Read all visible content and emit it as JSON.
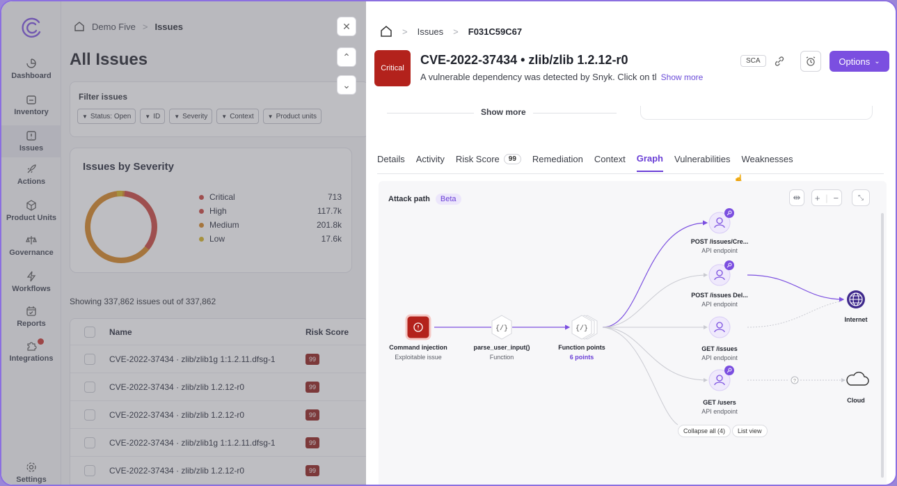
{
  "sidebar": {
    "items": [
      {
        "label": "Dashboard",
        "icon": "dashboard-icon"
      },
      {
        "label": "Inventory",
        "icon": "inventory-icon"
      },
      {
        "label": "Issues",
        "icon": "issues-icon"
      },
      {
        "label": "Actions",
        "icon": "rocket-icon"
      },
      {
        "label": "Product Units",
        "icon": "cube-icon"
      },
      {
        "label": "Governance",
        "icon": "scale-icon"
      },
      {
        "label": "Workflows",
        "icon": "bolt-icon"
      },
      {
        "label": "Reports",
        "icon": "calendar-icon"
      },
      {
        "label": "Integrations",
        "icon": "puzzle-icon"
      },
      {
        "label": "Settings",
        "icon": "gear-icon"
      }
    ]
  },
  "main": {
    "breadcrumb": {
      "home": "Demo Five",
      "current": "Issues"
    },
    "title": "All Issues",
    "filter": {
      "label": "Filter issues",
      "chips": [
        "Status: Open",
        "ID",
        "Severity",
        "Context",
        "Product units"
      ]
    },
    "severity_card": {
      "title": "Issues by Severity",
      "legend": [
        {
          "label": "Critical",
          "value": "713",
          "color": "#c9403a"
        },
        {
          "label": "High",
          "value": "117.7k",
          "color": "#c9403a"
        },
        {
          "label": "Medium",
          "value": "201.8k",
          "color": "#d4811b"
        },
        {
          "label": "Low",
          "value": "17.6k",
          "color": "#d6b21d"
        }
      ]
    },
    "showing": "Showing 337,862 issues out of 337,862",
    "table": {
      "headers": {
        "name": "Name",
        "risk": "Risk Score"
      },
      "rows": [
        {
          "name": "CVE-2022-37434 · zlib/zlib1g 1:1.2.11.dfsg-1",
          "risk": "99"
        },
        {
          "name": "CVE-2022-37434 · zlib/zlib 1.2.12-r0",
          "risk": "99"
        },
        {
          "name": "CVE-2022-37434 · zlib/zlib 1.2.12-r0",
          "risk": "99"
        },
        {
          "name": "CVE-2022-37434 · zlib/zlib1g 1:1.2.11.dfsg-1",
          "risk": "99"
        },
        {
          "name": "CVE-2022-37434 · zlib/zlib 1.2.12-r0",
          "risk": "99"
        }
      ]
    }
  },
  "panel": {
    "breadcrumb": {
      "section": "Issues",
      "id": "F031C59C67"
    },
    "severity": "Critical",
    "title": "CVE-2022-37434 • zlib/zlib 1.2.12-r0",
    "description": "A vulnerable dependency was detected by Snyk. Click on tl",
    "show_more_inline": "Show more",
    "tag": "SCA",
    "options_label": "Options",
    "show_more": "Show more",
    "tabs": [
      {
        "label": "Details"
      },
      {
        "label": "Activity"
      },
      {
        "label": "Risk Score",
        "count": "99"
      },
      {
        "label": "Remediation"
      },
      {
        "label": "Context"
      },
      {
        "label": "Graph",
        "active": true
      },
      {
        "label": "Vulnerabilities"
      },
      {
        "label": "Weaknesses"
      }
    ],
    "graph": {
      "title": "Attack path",
      "beta": "Beta",
      "nodes": {
        "cmd": {
          "label": "Command injection",
          "sub": "Exploitable issue"
        },
        "parse": {
          "label": "parse_user_input()",
          "sub": "Function"
        },
        "fp": {
          "label": "Function points",
          "sub": "6 points"
        },
        "ep1": {
          "label": "POST /issues/Cre...",
          "sub": "API endpoint"
        },
        "ep2": {
          "label": "POST /issues Del...",
          "sub": "API endpoint"
        },
        "ep3": {
          "label": "GET /issues",
          "sub": "API endpoint"
        },
        "ep4": {
          "label": "GET /users",
          "sub": "API endpoint"
        },
        "internet": {
          "label": "Internet"
        },
        "cloud": {
          "label": "Cloud"
        }
      },
      "buttons": {
        "collapse": "Collapse all (4)",
        "list": "List view"
      },
      "accent": "#7b4fe0"
    }
  }
}
